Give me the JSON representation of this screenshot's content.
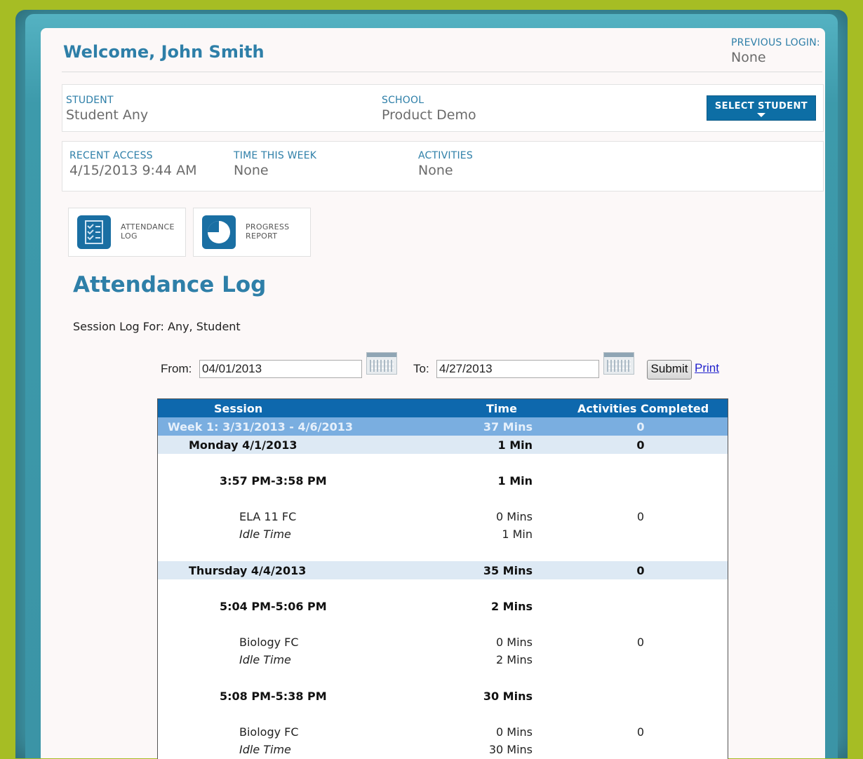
{
  "header": {
    "welcome": "Welcome, John Smith",
    "previous_login_label": "PREVIOUS LOGIN:",
    "previous_login_value": "None"
  },
  "student_box": {
    "student_label": "STUDENT",
    "student_value": "Student Any",
    "school_label": "SCHOOL",
    "school_value": "Product Demo",
    "select_student": "SELECT STUDENT"
  },
  "stats_box": {
    "recent_access_label": "RECENT ACCESS",
    "recent_access_value": "4/15/2013 9:44 AM",
    "time_week_label": "TIME THIS WEEK",
    "time_week_value": "None",
    "activities_label": "ACTIVITIES",
    "activities_value": "None"
  },
  "tiles": {
    "attendance_line1": "ATTENDANCE",
    "attendance_line2": "LOG",
    "progress_line1": "PROGRESS",
    "progress_line2": "REPORT"
  },
  "attendance": {
    "title": "Attendance Log",
    "session_for": "Session Log For: Any, Student",
    "from_label": "From:",
    "from_value": "04/01/2013",
    "to_label": "To:",
    "to_value": "4/27/2013",
    "submit": "Submit",
    "print": "Print"
  },
  "table": {
    "headers": {
      "session": "Session",
      "time": "Time",
      "activities": "Activities Completed"
    },
    "week": {
      "label": "Week 1: 3/31/2013 - 4/6/2013",
      "time": "37 Mins",
      "activities": "0"
    },
    "rows": [
      {
        "kind": "day",
        "session": "Monday 4/1/2013",
        "time": "1 Min",
        "activities": "0"
      },
      {
        "kind": "span",
        "session": "3:57 PM-3:58 PM",
        "time": "1 Min",
        "activities": ""
      },
      {
        "kind": "course",
        "session": "ELA 11 FC",
        "time": "0 Mins",
        "activities": "0"
      },
      {
        "kind": "idle",
        "session": "Idle Time",
        "time": "1 Min",
        "activities": ""
      },
      {
        "kind": "day",
        "session": "Thursday 4/4/2013",
        "time": "35 Mins",
        "activities": "0"
      },
      {
        "kind": "span",
        "session": "5:04 PM-5:06 PM",
        "time": "2 Mins",
        "activities": ""
      },
      {
        "kind": "course",
        "session": "Biology FC",
        "time": "0 Mins",
        "activities": "0"
      },
      {
        "kind": "idle",
        "session": "Idle Time",
        "time": "2 Mins",
        "activities": ""
      },
      {
        "kind": "span",
        "session": "5:08 PM-5:38 PM",
        "time": "30 Mins",
        "activities": ""
      },
      {
        "kind": "course",
        "session": "Biology FC",
        "time": "0 Mins",
        "activities": "0"
      },
      {
        "kind": "idle",
        "session": "Idle Time",
        "time": "30 Mins",
        "activities": ""
      }
    ]
  },
  "colors": {
    "accent": "#2e7fa8",
    "header_bar": "#0e68ad",
    "week_bar": "#7aaee0",
    "day_bar": "#dde9f4",
    "outer_frame": "#a6bd24"
  }
}
